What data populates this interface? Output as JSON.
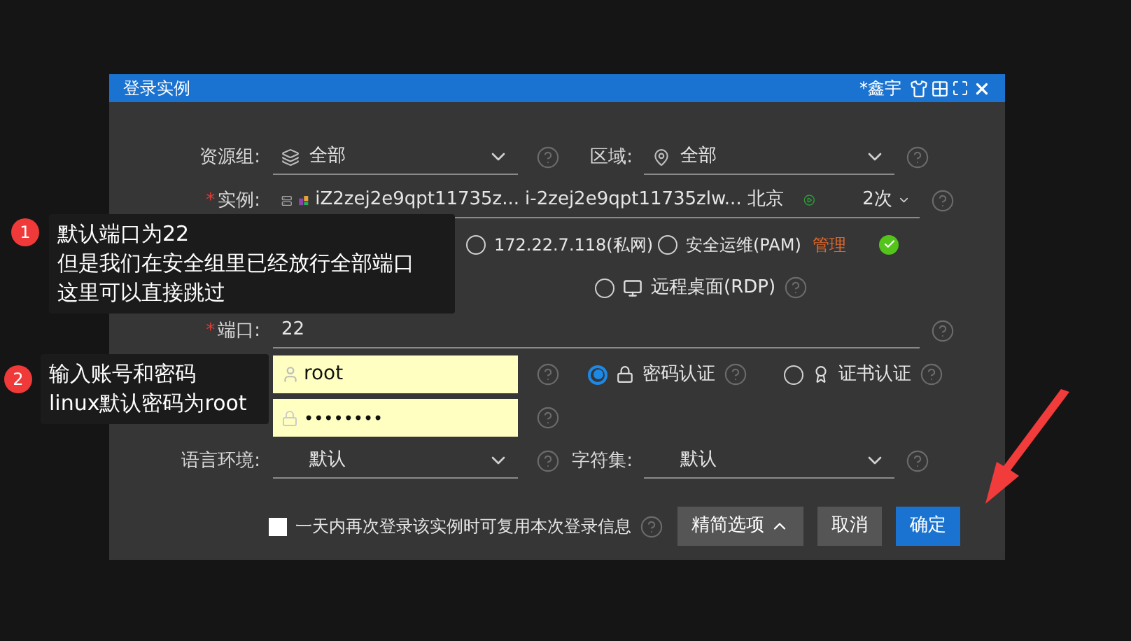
{
  "window": {
    "title": "登录实例",
    "user": "*鑫宇"
  },
  "resource_group": {
    "label": "资源组:",
    "value": "全部"
  },
  "region": {
    "label": "区域:",
    "value": "全部"
  },
  "instance": {
    "label": "实例:",
    "required_mark": "*",
    "name": "iZ2zej2e9qpt11735z...",
    "id": "i-2zej2e9qpt11735zlw...",
    "city": "北京",
    "count": "2次"
  },
  "network": {
    "options": [
      {
        "label": "172.22.7.118(私网)",
        "selected": false
      },
      {
        "label": "安全运维(PAM)",
        "selected": false
      }
    ],
    "manage_link": "管理"
  },
  "protocol": {
    "options": [
      {
        "label": "远程桌面(RDP)",
        "selected": false
      }
    ]
  },
  "port": {
    "label": "端口:",
    "required_mark": "*",
    "value": "22"
  },
  "username": {
    "value": "root"
  },
  "password": {
    "value": "••••••••"
  },
  "auth": {
    "options": [
      {
        "label": "密码认证",
        "selected": true,
        "kind": "password"
      },
      {
        "label": "证书认证",
        "selected": false,
        "kind": "certificate"
      }
    ]
  },
  "language": {
    "label": "语言环境:",
    "value": "默认"
  },
  "charset": {
    "label": "字符集:",
    "value": "默认"
  },
  "remember": {
    "label": "一天内再次登录该实例时可复用本次登录信息",
    "checked": false
  },
  "buttons": [
    {
      "label": "精简选项",
      "kind": "toggle"
    },
    {
      "label": "取消",
      "kind": "secondary"
    },
    {
      "label": "确定",
      "kind": "primary"
    }
  ],
  "callouts": [
    {
      "number": "1",
      "lines": [
        "默认端口为22",
        "但是我们在安全组里已经放行全部端口",
        "这里可以直接跳过"
      ]
    },
    {
      "number": "2",
      "lines": [
        "输入账号和密码",
        "linux默认密码为root"
      ]
    }
  ]
}
